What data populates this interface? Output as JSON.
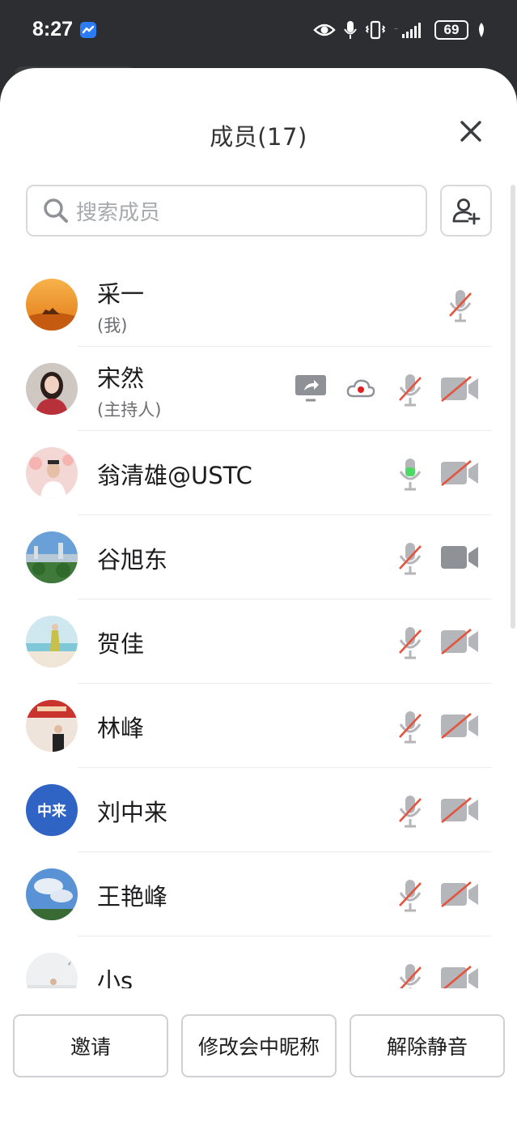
{
  "status_bar": {
    "time": "8:27",
    "battery": "69",
    "icons": [
      "app-badge-icon",
      "eye-icon",
      "mic-icon",
      "vibrate-icon",
      "signal-icon",
      "battery-icon",
      "leaf-icon"
    ]
  },
  "header": {
    "title": "成员(17)"
  },
  "search": {
    "placeholder": "搜索成员"
  },
  "members": [
    {
      "name": "采一",
      "role": "(我)",
      "mic": "muted",
      "camera": "none",
      "screen_share": false,
      "recording": false
    },
    {
      "name": "宋然",
      "role": "(主持人)",
      "mic": "muted",
      "camera": "off",
      "screen_share": true,
      "recording": true
    },
    {
      "name": "翁清雄@USTC",
      "role": "",
      "mic": "active",
      "camera": "off",
      "screen_share": false,
      "recording": false
    },
    {
      "name": "谷旭东",
      "role": "",
      "mic": "muted",
      "camera": "on",
      "screen_share": false,
      "recording": false
    },
    {
      "name": "贺佳",
      "role": "",
      "mic": "muted",
      "camera": "off",
      "screen_share": false,
      "recording": false
    },
    {
      "name": "林峰",
      "role": "",
      "mic": "muted",
      "camera": "off",
      "screen_share": false,
      "recording": false
    },
    {
      "name": "刘中来",
      "role": "",
      "avatar_text": "中来",
      "mic": "muted",
      "camera": "off",
      "screen_share": false,
      "recording": false
    },
    {
      "name": "王艳峰",
      "role": "",
      "mic": "muted",
      "camera": "off",
      "screen_share": false,
      "recording": false
    },
    {
      "name": "小s",
      "role": "",
      "mic": "muted",
      "camera": "off",
      "screen_share": false,
      "recording": false
    }
  ],
  "footer": {
    "invite_label": "邀请",
    "rename_label": "修改会中昵称",
    "unmute_label": "解除静音"
  },
  "colors": {
    "accent_green": "#4cd964",
    "muted_red": "#e5533d",
    "icon_gray": "#8e9196",
    "record_red": "#e02020",
    "avatar_blue": "#2f63c4"
  }
}
